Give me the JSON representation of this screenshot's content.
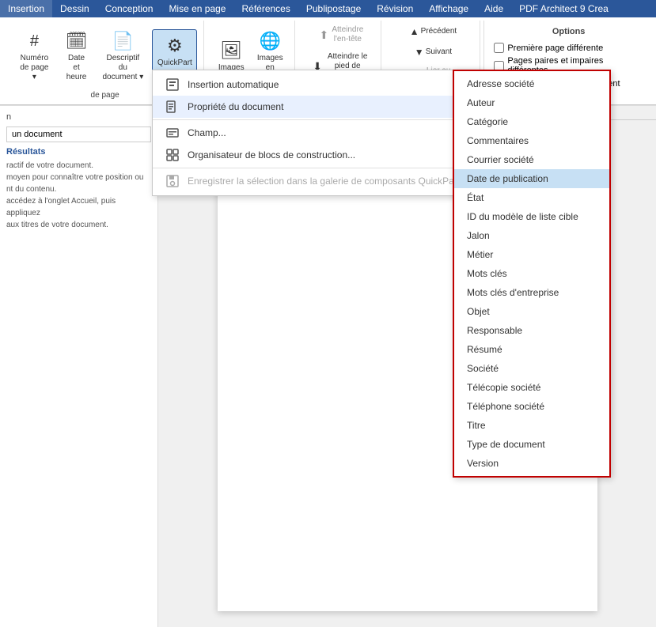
{
  "ribbon": {
    "tabs": [
      "Insertion",
      "Dessin",
      "Conception",
      "Mise en page",
      "Références",
      "Publipostage",
      "Révision",
      "Affichage",
      "Aide",
      "PDF Architect 9 Crea"
    ],
    "active_tab": "Insertion",
    "groups": [
      {
        "name": "pages",
        "label": "de page",
        "buttons": [
          {
            "id": "numero",
            "label": "Numéro\nde page",
            "icon": "#"
          },
          {
            "id": "date",
            "label": "Date et\nheure",
            "icon": "📅"
          },
          {
            "id": "descriptif",
            "label": "Descriptif du\ndocument",
            "icon": "📄"
          },
          {
            "id": "quickpart",
            "label": "QuickPart",
            "icon": "⚙",
            "highlighted": true
          }
        ]
      },
      {
        "name": "images",
        "label": "",
        "buttons": [
          {
            "id": "images",
            "label": "Images",
            "icon": "🖼"
          },
          {
            "id": "images-en-ligne",
            "label": "Images\nen ligne",
            "icon": "🌐"
          }
        ]
      },
      {
        "name": "navigation",
        "label": "",
        "buttons": [
          {
            "id": "atteindre-entete",
            "label": "Atteindre\nl'en-tête",
            "icon": "⬆",
            "disabled": true
          },
          {
            "id": "atteindre-pied",
            "label": "Atteindre le\npied de page",
            "icon": "⬇"
          }
        ]
      },
      {
        "name": "navlinks",
        "label": "",
        "buttons": [
          {
            "id": "precedent",
            "label": "Précédent",
            "icon": "▲"
          },
          {
            "id": "suivant",
            "label": "Suivant",
            "icon": "▼"
          },
          {
            "id": "lier",
            "label": "Lier au précédent",
            "icon": "🔗",
            "disabled": true
          }
        ]
      }
    ],
    "right_options": {
      "title": "Options",
      "checkboxes": [
        {
          "label": "Première page différente",
          "checked": false
        },
        {
          "label": "Pages paires et impaires différentes",
          "checked": false
        },
        {
          "label": "Afficher le texte du document",
          "checked": true
        }
      ]
    }
  },
  "dropdown": {
    "items": [
      {
        "id": "insertion-auto",
        "label": "Insertion automatique",
        "icon": "📋",
        "has_sub": true
      },
      {
        "id": "propriete-doc",
        "label": "Propriété du document",
        "icon": "📄",
        "has_sub": true,
        "active": true
      },
      {
        "id": "champ",
        "label": "Champ...",
        "icon": "≡"
      },
      {
        "id": "organisateur",
        "label": "Organisateur de blocs de construction...",
        "icon": "🧱"
      },
      {
        "id": "enregistrer",
        "label": "Enregistrer la sélection dans la galerie de composants QuickPart...",
        "icon": "💾",
        "disabled": true
      }
    ]
  },
  "submenu": {
    "items": [
      {
        "label": "Adresse société"
      },
      {
        "label": "Auteur"
      },
      {
        "label": "Catégorie"
      },
      {
        "label": "Commentaires"
      },
      {
        "label": "Courrier société"
      },
      {
        "label": "Date de publication",
        "highlighted": true
      },
      {
        "label": "État"
      },
      {
        "label": "ID du modèle de liste cible"
      },
      {
        "label": "Jalon"
      },
      {
        "label": "Métier"
      },
      {
        "label": "Mots clés"
      },
      {
        "label": "Mots clés d'entreprise"
      },
      {
        "label": "Objet"
      },
      {
        "label": "Responsable"
      },
      {
        "label": "Résumé"
      },
      {
        "label": "Société"
      },
      {
        "label": "Télécopie société"
      },
      {
        "label": "Téléphone société"
      },
      {
        "label": "Titre"
      },
      {
        "label": "Type de document"
      },
      {
        "label": "Version"
      }
    ]
  },
  "left_panel": {
    "search_placeholder": "",
    "search_value": "un document",
    "results_label": "Résultats",
    "nav_texts": [
      "ractif de votre document.",
      "moyen pour connaître votre position ou",
      "nt du contenu.",
      "accédez à l'onglet Accueil, puis appliquez",
      "aux titres de votre document."
    ]
  },
  "ruler": {
    "label": "2 ·"
  }
}
